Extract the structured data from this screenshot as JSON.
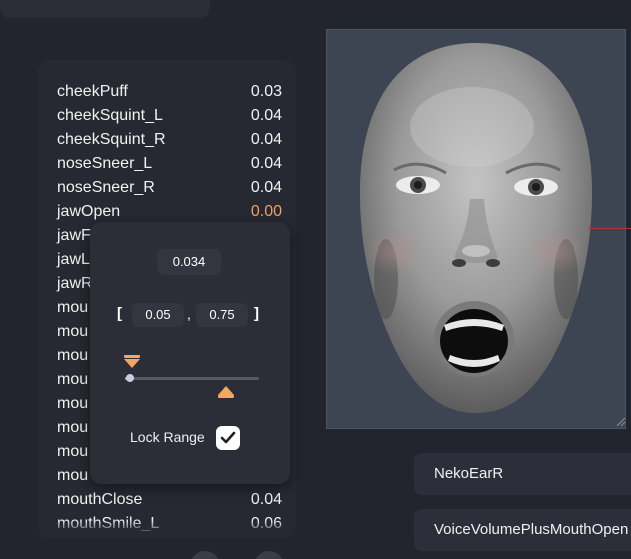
{
  "blendshapes": [
    {
      "name": "cheekPuff",
      "value": "0.03"
    },
    {
      "name": "cheekSquint_L",
      "value": "0.04"
    },
    {
      "name": "cheekSquint_R",
      "value": "0.04"
    },
    {
      "name": "noseSneer_L",
      "value": "0.04"
    },
    {
      "name": "noseSneer_R",
      "value": "0.04"
    },
    {
      "name": "jawOpen",
      "value": "0.00",
      "highlighted": true
    },
    {
      "name": "jawF",
      "value": ""
    },
    {
      "name": "jawL",
      "value": ""
    },
    {
      "name": "jawR",
      "value": ""
    },
    {
      "name": "mou",
      "value": ""
    },
    {
      "name": "mou",
      "value": ""
    },
    {
      "name": "mou",
      "value": ""
    },
    {
      "name": "mou",
      "value": ""
    },
    {
      "name": "mou",
      "value": ""
    },
    {
      "name": "mou",
      "value": ""
    },
    {
      "name": "mou",
      "value": ""
    },
    {
      "name": "mou",
      "value": ""
    },
    {
      "name": "mouthClose",
      "value": "0.04"
    },
    {
      "name": "mouthSmile_L",
      "value": "0.06"
    }
  ],
  "range_popover": {
    "current_value": "0.034",
    "open_bracket": "[",
    "close_bracket": "]",
    "separator": ",",
    "min": "0.05",
    "max": "0.75",
    "slider_value_fraction": 0.034,
    "min_fraction": 0.05,
    "max_fraction": 0.75,
    "lock_label": "Lock Range",
    "lock_checked": true
  },
  "preview": {
    "face_icon": "3d-head-preview"
  },
  "cards": [
    {
      "label": "NekoEarR"
    },
    {
      "label": "VoiceVolumePlusMouthOpen"
    }
  ],
  "colors": {
    "accent": "#f2a860",
    "highlight_value": "#f0a060",
    "panel": "#262932",
    "background": "#22252e"
  }
}
